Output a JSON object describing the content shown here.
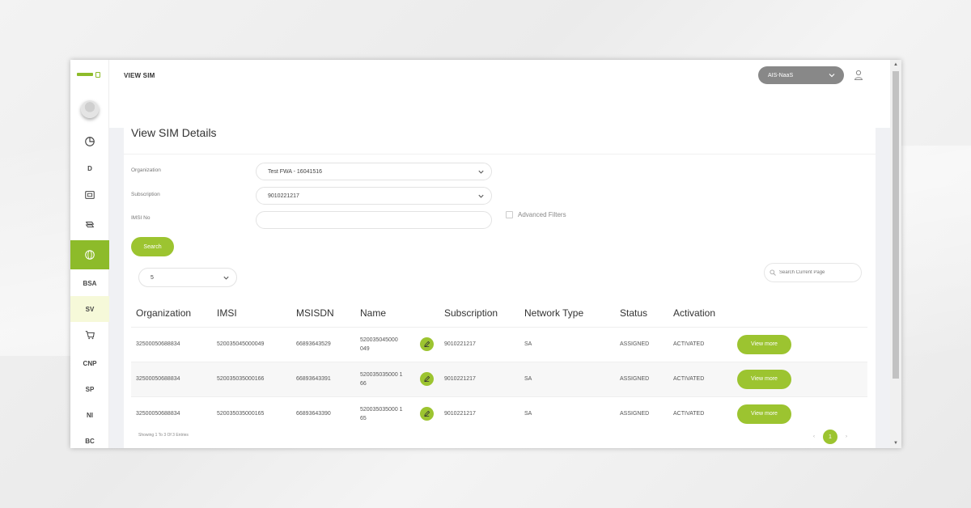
{
  "header": {
    "page_label": "VIEW SIM",
    "org_selector": "AIS-NaaS"
  },
  "sidebar": {
    "items": [
      {
        "label": "",
        "icon": "pie-chart-icon"
      },
      {
        "label": "D",
        "icon": ""
      },
      {
        "label": "",
        "icon": "sim-card-icon"
      },
      {
        "label": "",
        "icon": "document-stack-icon"
      },
      {
        "label": "",
        "icon": "globe-icon",
        "active": true
      },
      {
        "label": "BSA",
        "icon": ""
      },
      {
        "label": "SV",
        "icon": ""
      },
      {
        "label": "",
        "icon": "cart-icon"
      },
      {
        "label": "CNP",
        "icon": ""
      },
      {
        "label": "SP",
        "icon": ""
      },
      {
        "label": "NI",
        "icon": ""
      },
      {
        "label": "BC",
        "icon": ""
      }
    ]
  },
  "card": {
    "title": "View SIM Details",
    "filters": {
      "organization_label": "Organization",
      "organization_value": "Test FWA - 16041516",
      "subscription_label": "Subscription",
      "subscription_value": "9010221217",
      "imsi_label": "IMSI No",
      "imsi_value": "",
      "advanced_filters": "Advanced Filters",
      "search_button": "Search"
    },
    "rows_per_page": "5",
    "page_search_placeholder": "Search Current Page",
    "table": {
      "columns": [
        "Organization",
        "IMSI",
        "MSISDN",
        "Name",
        "Subscription",
        "Network Type",
        "Status",
        "Activation"
      ],
      "rows": [
        {
          "organization": "32500050688834",
          "imsi": "520035045000049",
          "msisdn": "66893643529",
          "name_1": "520035045000",
          "name_2": "049",
          "subscription": "9010221217",
          "network_type": "SA",
          "status": "ASSIGNED",
          "activation": "ACTIVATED",
          "action": "View more"
        },
        {
          "organization": "32500050688834",
          "imsi": "520035035000166",
          "msisdn": "66893643391",
          "name_1": "520035035000 1",
          "name_2": "66",
          "subscription": "9010221217",
          "network_type": "SA",
          "status": "ASSIGNED",
          "activation": "ACTIVATED",
          "action": "View more"
        },
        {
          "organization": "32500050688834",
          "imsi": "520035035000165",
          "msisdn": "66893643390",
          "name_1": "520035035000 1",
          "name_2": "65",
          "subscription": "9010221217",
          "network_type": "SA",
          "status": "ASSIGNED",
          "activation": "ACTIVATED",
          "action": "View more"
        }
      ]
    },
    "showing_text": "Showing 1 To 3 Of 3 Entries",
    "pagination": {
      "prev": "‹",
      "current": "1",
      "next": "›"
    }
  },
  "colors": {
    "accent": "#9cc430",
    "selector_bg": "#888888"
  }
}
